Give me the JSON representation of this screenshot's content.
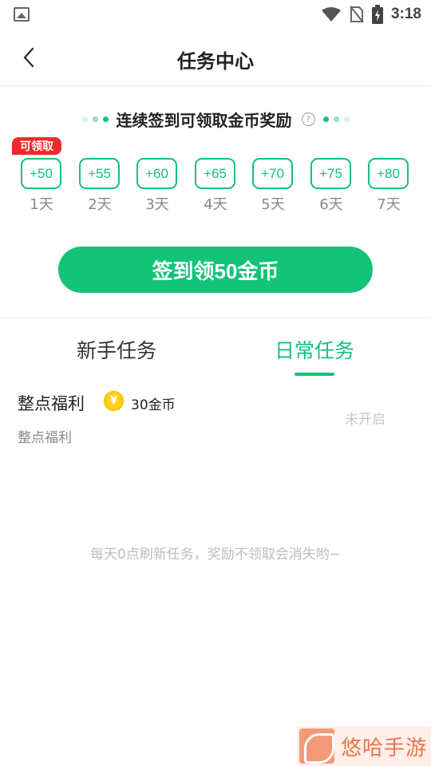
{
  "status_bar": {
    "time": "3:18",
    "icons": [
      "gallery-icon",
      "wifi-icon",
      "no-sim-icon",
      "battery-charging-icon"
    ]
  },
  "header": {
    "title": "任务中心",
    "back_icon": "chevron-left-icon"
  },
  "checkin": {
    "title": "连续签到可领取金币奖励",
    "help_symbol": "?",
    "badge": "可领取",
    "days": [
      {
        "reward": "+50",
        "label": "1天"
      },
      {
        "reward": "+55",
        "label": "2天"
      },
      {
        "reward": "+60",
        "label": "3天"
      },
      {
        "reward": "+65",
        "label": "4天"
      },
      {
        "reward": "+70",
        "label": "5天"
      },
      {
        "reward": "+75",
        "label": "6天"
      },
      {
        "reward": "+80",
        "label": "7天"
      }
    ],
    "button_label": "签到领50金币"
  },
  "tabs": [
    {
      "label": "新手任务",
      "active": false
    },
    {
      "label": "日常任务",
      "active": true
    }
  ],
  "tasks": [
    {
      "name": "整点福利",
      "coin_symbol": "¥",
      "reward": "30金币",
      "subtitle": "整点福利",
      "status": "未开启"
    }
  ],
  "footer_note": "每天0点刷新任务，奖励不领取会消失哟~",
  "watermark": {
    "text": "悠哈手游"
  },
  "colors": {
    "accent": "#12c378",
    "badge": "#ee2b2b",
    "coin": "#ffd21a",
    "muted": "#888888"
  }
}
